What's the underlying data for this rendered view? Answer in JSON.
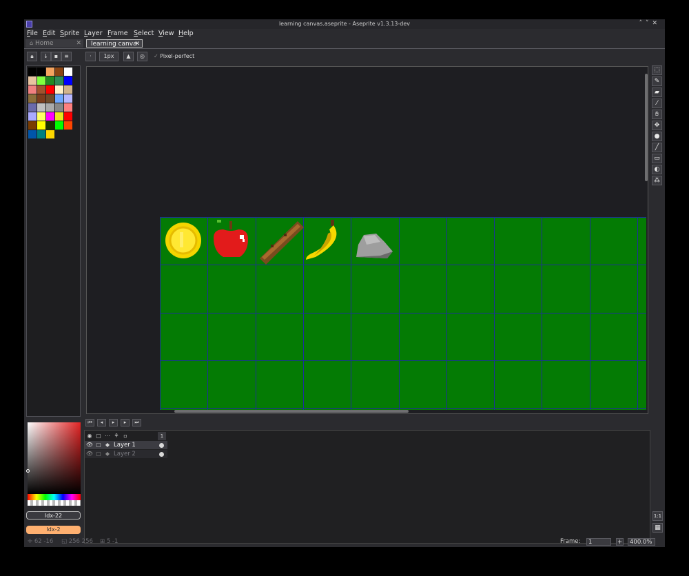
{
  "window": {
    "title": "learning canvas.aseprite - Aseprite v1.3.13-dev",
    "controls": [
      "˄",
      "˅",
      "✕"
    ]
  },
  "menu": [
    "File",
    "Edit",
    "Sprite",
    "Layer",
    "Frame",
    "Select",
    "View",
    "Help"
  ],
  "tabs": [
    {
      "label": "Home",
      "icon": "home-icon",
      "close": "✕"
    },
    {
      "label": "learning canva",
      "close": "✕"
    }
  ],
  "toolbar": {
    "brush_size": "1px",
    "pixel_perfect_label": "Pixel-perfect",
    "dot": "·"
  },
  "palette": {
    "colors": [
      "#000000",
      "#222034",
      "#45283c",
      "#663931",
      "#8f563b",
      "#df7126",
      "#d9a066",
      "#eec39a",
      "#fbf236",
      "#99e550",
      "#6abe30",
      "#37946e",
      "#4b692f",
      "#524b24",
      "#323c39",
      "#3f3f74",
      "#306082",
      "#5b6ee1",
      "#639bff",
      "#5fcde4",
      "#cbdbfc",
      "#ffffff",
      "#9badb7",
      "#847e87",
      "#696a6a",
      "#595652",
      "#76428a",
      "#ac3232",
      "#d95763",
      "#d77bba",
      "#8f974a",
      "#8a6f30"
    ],
    "grid": [
      [
        "#000000",
        "#000000",
        "#f4a460",
        "#8b4513",
        "#ffffff"
      ],
      [
        "#e8c4a0",
        "#7fff3f",
        "#228b22",
        "#2e8b57",
        "#0000ff"
      ],
      [
        "#f08080",
        "#a0522d",
        "#ff0000",
        "#fff0c8",
        "#d2b48c"
      ],
      [
        "#8b6d3a",
        "#7b3d1d",
        "#6e4b2a",
        "#6fa8ff",
        "#b8b8ff"
      ],
      [
        "#6a6aaa",
        "#c0c0c0",
        "#aaaaaa",
        "#888888",
        "#ff8080"
      ],
      [
        "#aaaaff",
        "#ffff66",
        "#ff00ff",
        "#e8e81e",
        "#ff0000"
      ],
      [
        "#7a3c00",
        "#ffff00",
        "#1a3300",
        "#00ff00",
        "#ff4500"
      ],
      [
        "#0055aa",
        "#008080",
        "#ffd700"
      ]
    ]
  },
  "colors": {
    "fg_index": "Idx-22",
    "bg_index": "Idx-2",
    "bg_color": "#ffb070",
    "grid_green": "#047b04",
    "grid_line": "#1d2f9a"
  },
  "sprites": [
    "coin",
    "apple",
    "stick",
    "banana",
    "rock"
  ],
  "timeline": {
    "frame_number": "1",
    "layers": [
      {
        "name": "Layer 1",
        "active": true
      },
      {
        "name": "Layer 2",
        "active": false
      }
    ]
  },
  "status": {
    "position": "62  -16",
    "size": "256  256",
    "grid": "5  -1",
    "frame_label": "Frame:",
    "frame_value": "1",
    "zoom": "400.0%",
    "one_to_one": "1:1"
  }
}
